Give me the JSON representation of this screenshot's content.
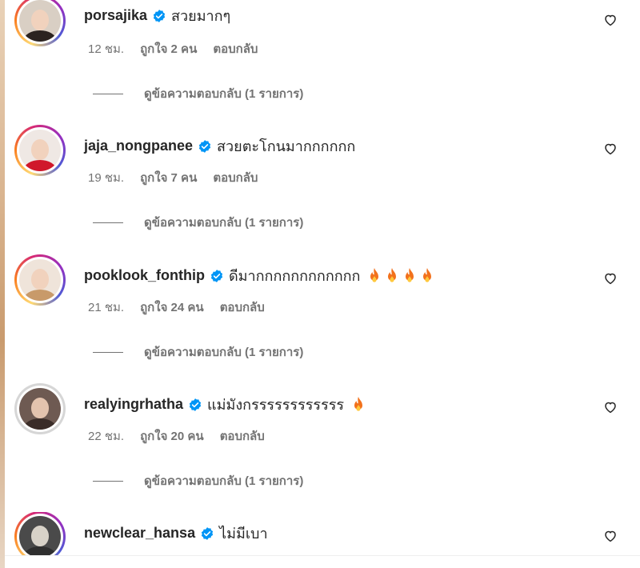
{
  "comments": [
    {
      "username": "porsajika",
      "text": "สวยมากๆ",
      "emoji_count": 0,
      "time": "12 ชม.",
      "likes": "ถูกใจ 2 คน",
      "reply": "ตอบกลับ",
      "view_replies": "ดูข้อความตอบกลับ (1 รายการ)",
      "avatar_colors": [
        "#d9cfc4",
        "#2b2320"
      ]
    },
    {
      "username": "jaja_nongpanee",
      "text": "สวยตะโกนมากกกกกก",
      "emoji_count": 0,
      "time": "19 ชม.",
      "likes": "ถูกใจ 7 คน",
      "reply": "ตอบกลับ",
      "view_replies": "ดูข้อความตอบกลับ (1 รายการ)",
      "avatar_colors": [
        "#efe8e4",
        "#d0182b"
      ]
    },
    {
      "username": "pooklook_fonthip",
      "text": "ดีมากกกกกกกกกกกก",
      "emoji_count": 4,
      "time": "21 ชม.",
      "likes": "ถูกใจ 24 คน",
      "reply": "ตอบกลับ",
      "view_replies": "ดูข้อความตอบกลับ (1 รายการ)",
      "avatar_colors": [
        "#efe4da",
        "#c89a6a"
      ]
    },
    {
      "username": "realyingrhatha",
      "text": "แม่มังกรรรรรรรรรรรร",
      "emoji_count": 1,
      "time": "22 ชม.",
      "likes": "ถูกใจ 20 คน",
      "reply": "ตอบกลับ",
      "view_replies": "ดูข้อความตอบกลับ (1 รายการ)",
      "avatar_colors": [
        "#6e5a52",
        "#3a2c28"
      ]
    },
    {
      "username": "newclear_hansa",
      "text": "ไม่มีเบา",
      "emoji_count": 0,
      "time": "",
      "likes": "",
      "reply": "",
      "view_replies": "",
      "avatar_colors": [
        "#4a4a4a",
        "#d8d2c8"
      ]
    }
  ],
  "colors": {
    "verified": "#0095f6",
    "secondary_text": "#737373",
    "emoji_flame": "#f2711c"
  },
  "icons": {
    "like": "heart-icon",
    "verified": "verified-badge-icon",
    "emoji": "fire-emoji-icon"
  }
}
